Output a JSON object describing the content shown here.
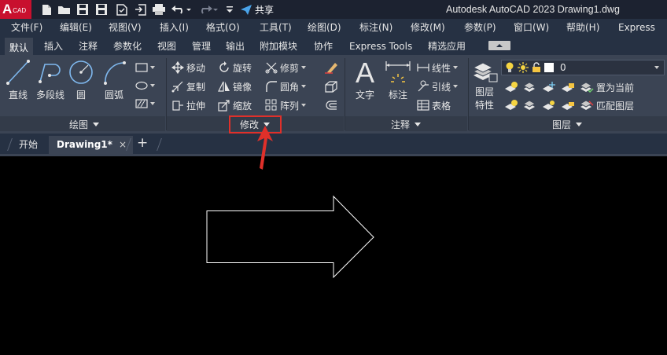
{
  "titlebar": {
    "logo_letter": "A",
    "logo_sub": "CAD",
    "share_label": "共享",
    "title": "Autodesk AutoCAD 2023    Drawing1.dwg"
  },
  "menubar": {
    "items": [
      "文件(F)",
      "编辑(E)",
      "视图(V)",
      "插入(I)",
      "格式(O)",
      "工具(T)",
      "绘图(D)",
      "标注(N)",
      "修改(M)",
      "参数(P)",
      "窗口(W)",
      "帮助(H)",
      "Express"
    ]
  },
  "ribbon_tabs": {
    "items": [
      "默认",
      "插入",
      "注释",
      "参数化",
      "视图",
      "管理",
      "输出",
      "附加模块",
      "协作",
      "Express Tools",
      "精选应用"
    ],
    "active_index": 0
  },
  "panels": {
    "draw": {
      "title": "绘图",
      "line": "直线",
      "polyline": "多段线",
      "circle": "圆",
      "arc": "圆弧"
    },
    "modify": {
      "title": "修改",
      "move": "移动",
      "rotate": "旋转",
      "trim": "修剪",
      "copy": "复制",
      "mirror": "镜像",
      "fillet": "圆角",
      "stretch": "拉伸",
      "scale": "缩放",
      "array": "阵列"
    },
    "annotation": {
      "title": "注释",
      "text": "文字",
      "dimension": "标注",
      "linear": "线性",
      "leader": "引线",
      "table": "表格"
    },
    "layers": {
      "title": "图层",
      "properties_line1": "图层",
      "properties_line2": "特性",
      "current_layer": "0",
      "set_current": "置为当前",
      "match_layer": "匹配图层"
    }
  },
  "doc_tabs": {
    "start": "开始",
    "drawing": "Drawing1*",
    "close": "×",
    "add": "+"
  },
  "colors": {
    "highlight": "#e0302a",
    "logo": "#c8102e",
    "ribbon": "#3b4454",
    "menubar": "#263143"
  }
}
